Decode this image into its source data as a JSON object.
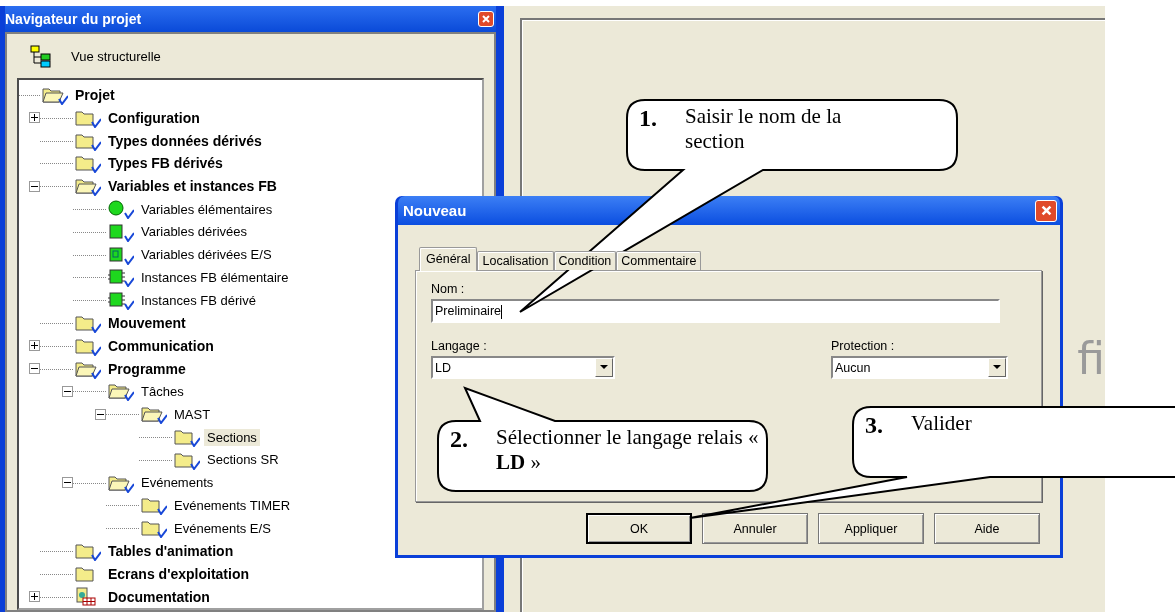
{
  "navigator": {
    "title": "Navigateur du projet",
    "view_label": "Vue structurelle",
    "tree": {
      "label": "Projet",
      "kind": "folder-open",
      "selected": false,
      "children": [
        {
          "label": "Configuration",
          "kind": "folder",
          "expanded": false,
          "selected": false
        },
        {
          "label": "Types données dérivés",
          "kind": "folder",
          "selected": false
        },
        {
          "label": "Types FB dérivés",
          "kind": "folder",
          "selected": false
        },
        {
          "label": "Variables et instances FB",
          "kind": "folder-open",
          "expanded": true,
          "selected": false,
          "children": [
            {
              "label": "Variables élémentaires",
              "kind": "ball",
              "selected": false
            },
            {
              "label": "Variables dérivées",
              "kind": "block",
              "selected": false
            },
            {
              "label": "Variables dérivées E/S",
              "kind": "io",
              "selected": false
            },
            {
              "label": "Instances FB élémentaire",
              "kind": "fb",
              "selected": false
            },
            {
              "label": "Instances FB dérivé",
              "kind": "fb",
              "selected": false
            }
          ]
        },
        {
          "label": "Mouvement",
          "kind": "folder",
          "selected": false
        },
        {
          "label": "Communication",
          "kind": "folder",
          "expanded": false,
          "selected": false
        },
        {
          "label": "Programme",
          "kind": "folder-open",
          "expanded": true,
          "selected": false,
          "children": [
            {
              "label": "Tâches",
              "kind": "folder-open",
              "expanded": true,
              "selected": false,
              "children": [
                {
                  "label": "MAST",
                  "kind": "folder-open",
                  "expanded": true,
                  "selected": false,
                  "children": [
                    {
                      "label": "Sections",
                      "kind": "folder",
                      "selected": true
                    },
                    {
                      "label": "Sections SR",
                      "kind": "folder",
                      "selected": false
                    }
                  ]
                }
              ]
            },
            {
              "label": "Evénements",
              "kind": "folder-open",
              "expanded": true,
              "selected": false,
              "children": [
                {
                  "label": "Evénements TIMER",
                  "kind": "folder",
                  "selected": false
                },
                {
                  "label": "Evénements E/S",
                  "kind": "folder",
                  "selected": false
                }
              ]
            }
          ]
        },
        {
          "label": "Tables d'animation",
          "kind": "folder",
          "selected": false
        },
        {
          "label": "Ecrans d'exploitation",
          "kind": "folder-plain",
          "selected": false
        },
        {
          "label": "Documentation",
          "kind": "doc",
          "expanded": false,
          "selected": false
        }
      ]
    }
  },
  "background_fragment": "fi",
  "dialog": {
    "title": "Nouveau",
    "tabs": [
      {
        "label": "Général",
        "selected": true
      },
      {
        "label": "Localisation",
        "selected": false
      },
      {
        "label": "Condition",
        "selected": false
      },
      {
        "label": "Commentaire",
        "selected": false
      }
    ],
    "name_label": "Nom :",
    "name_value": "Preliminaire",
    "language_label": "Langage :",
    "language_value": "LD",
    "protection_label": "Protection :",
    "protection_value": "Aucun",
    "buttons": [
      {
        "label": "OK",
        "default": true
      },
      {
        "label": "Annuler",
        "default": false
      },
      {
        "label": "Appliquer",
        "default": false
      },
      {
        "label": "Aide",
        "default": false
      }
    ]
  },
  "callouts": [
    {
      "number": "1.",
      "text": "Saisir le nom de la section"
    },
    {
      "number": "2.",
      "text": "Sélectionner le langage relais « **LD** »"
    },
    {
      "number": "3.",
      "text": "Valider"
    }
  ]
}
